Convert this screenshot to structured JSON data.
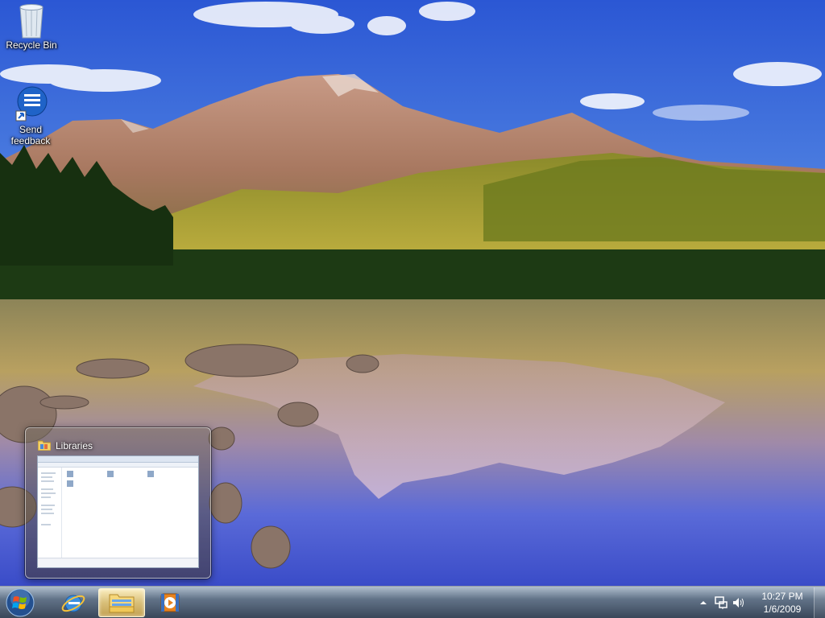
{
  "desktop": {
    "icons": [
      {
        "label": "Recycle Bin",
        "icon": "recycle-bin-icon"
      },
      {
        "label": "Send feedback",
        "icon": "send-feedback-icon"
      }
    ]
  },
  "thumbnail": {
    "title": "Libraries",
    "icon": "libraries-folder-icon"
  },
  "taskbar": {
    "start_icon": "windows-orb-icon",
    "pinned": [
      {
        "name": "Internet Explorer",
        "icon": "internet-explorer-icon"
      },
      {
        "name": "Windows Explorer",
        "icon": "windows-explorer-icon",
        "active": true
      },
      {
        "name": "Windows Media Player",
        "icon": "media-player-icon"
      }
    ],
    "tray": {
      "icons": [
        "show-hidden-icons-chevron",
        "network-icon",
        "volume-icon"
      ],
      "time": "10:27 PM",
      "date": "1/6/2009"
    }
  },
  "colors": {
    "sky_top": "#2f5fd8",
    "sky_bottom": "#7fa8ea",
    "taskbar": "#3a4d66",
    "active_button": "#e8c878"
  }
}
